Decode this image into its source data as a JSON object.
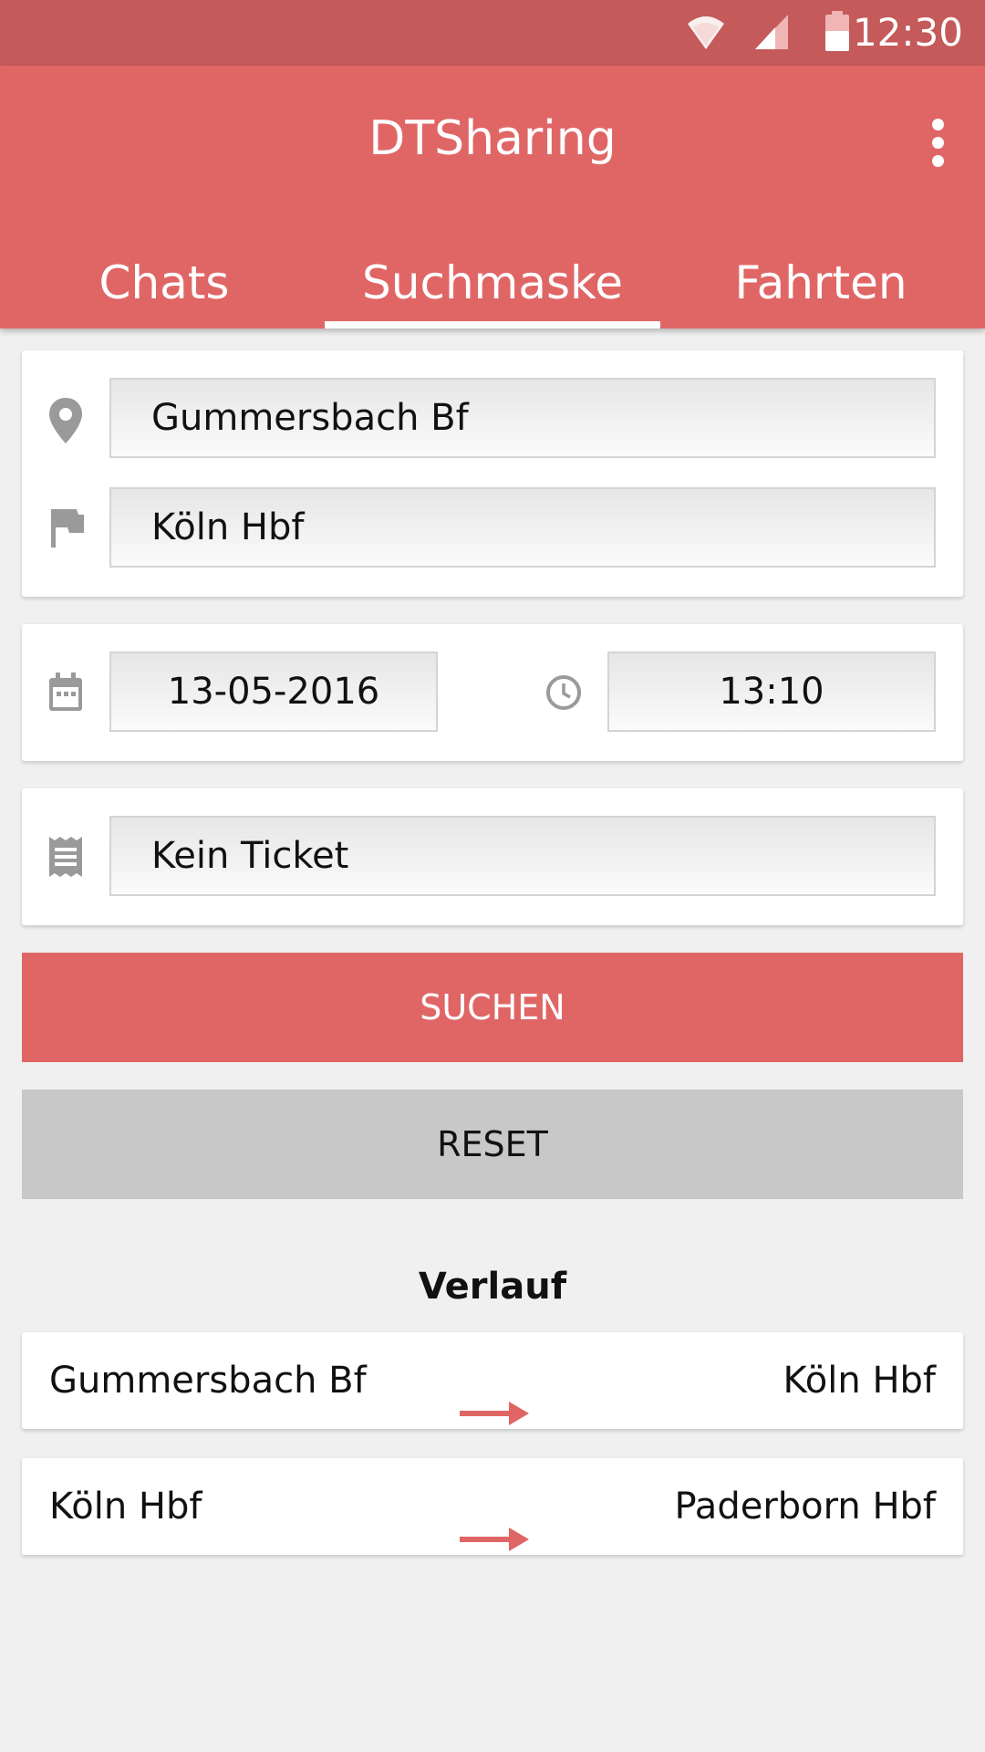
{
  "status_bar": {
    "time": "12:30",
    "icons": [
      "wifi-icon",
      "signal-icon",
      "battery-icon"
    ]
  },
  "app": {
    "title": "DTSharing"
  },
  "tabs": [
    {
      "label": "Chats"
    },
    {
      "label": "Suchmaske",
      "active": true
    },
    {
      "label": "Fahrten"
    }
  ],
  "route": {
    "from": "Gummersbach Bf",
    "to": "Köln Hbf"
  },
  "datetime": {
    "date": "13-05-2016",
    "time": "13:10"
  },
  "ticket": {
    "value": "Kein Ticket"
  },
  "buttons": {
    "search": "SUCHEN",
    "reset": "RESET"
  },
  "history": {
    "title": "Verlauf",
    "items": [
      {
        "from": "Gummersbach Bf",
        "to": "Köln Hbf"
      },
      {
        "from": "Köln Hbf",
        "to": "Paderborn Hbf"
      }
    ]
  },
  "colors": {
    "accent": "#e06666",
    "status_bar": "#c45a5a",
    "background": "#f0f0f0",
    "reset_button": "#c8c8c8"
  }
}
